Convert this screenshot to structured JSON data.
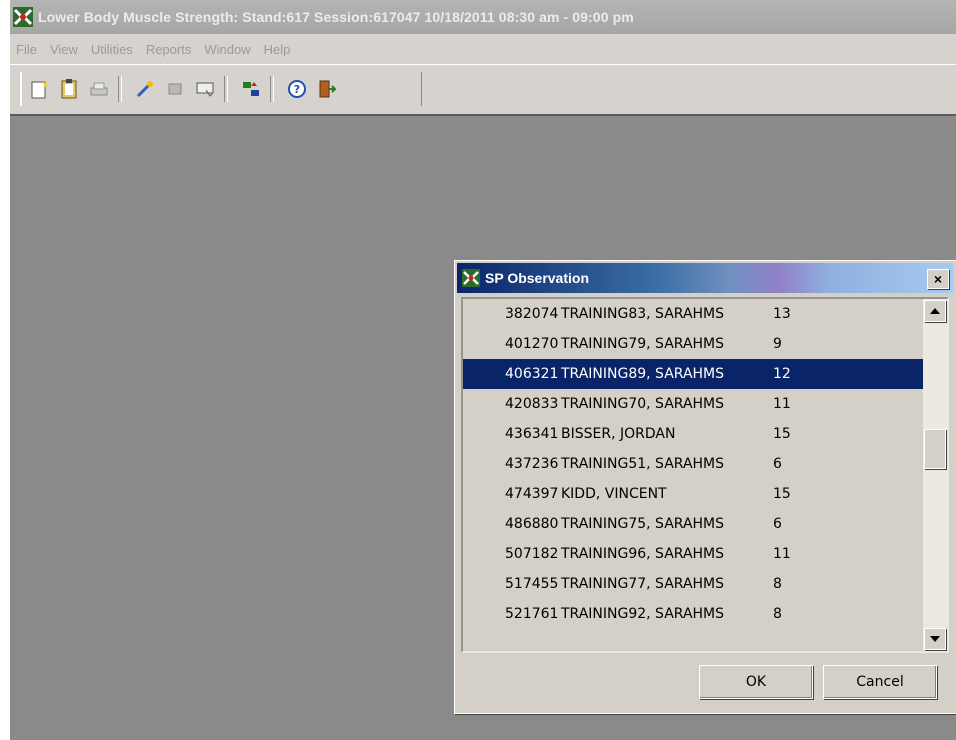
{
  "window": {
    "title": "Lower Body Muscle Strength: Stand:617 Session:617047 10/18/2011 08:30 am - 09:00 pm"
  },
  "menu": [
    "File",
    "View",
    "Utilities",
    "Reports",
    "Window",
    "Help"
  ],
  "toolbar": {
    "icons": [
      "new-icon",
      "clipboard-icon",
      "print-icon",
      "wand-icon",
      "grid-icon",
      "card-icon",
      "sort-icon",
      "help-icon",
      "exit-icon"
    ]
  },
  "dialog": {
    "title": "SP Observation",
    "close_glyph": "×",
    "rows": [
      {
        "id": "382074",
        "name": "TRAINING83, SARAHMS",
        "value": "13"
      },
      {
        "id": "401270",
        "name": "TRAINING79, SARAHMS",
        "value": "9"
      },
      {
        "id": "406321",
        "name": "TRAINING89, SARAHMS",
        "value": "12"
      },
      {
        "id": "420833",
        "name": "TRAINING70, SARAHMS",
        "value": "11"
      },
      {
        "id": "436341",
        "name": "BISSER, JORDAN",
        "value": "15"
      },
      {
        "id": "437236",
        "name": "TRAINING51, SARAHMS",
        "value": "6"
      },
      {
        "id": "474397",
        "name": "KIDD, VINCENT",
        "value": "15"
      },
      {
        "id": "486880",
        "name": "TRAINING75, SARAHMS",
        "value": "6"
      },
      {
        "id": "507182",
        "name": "TRAINING96, SARAHMS",
        "value": "11"
      },
      {
        "id": "517455",
        "name": "TRAINING77, SARAHMS",
        "value": "8"
      },
      {
        "id": "521761",
        "name": "TRAINING92, SARAHMS",
        "value": "8"
      }
    ],
    "selected_index": 2,
    "ok_label": "OK",
    "cancel_label": "Cancel"
  },
  "colors": {
    "selection": "#0a246a",
    "workspace": "#8a8a8a"
  }
}
